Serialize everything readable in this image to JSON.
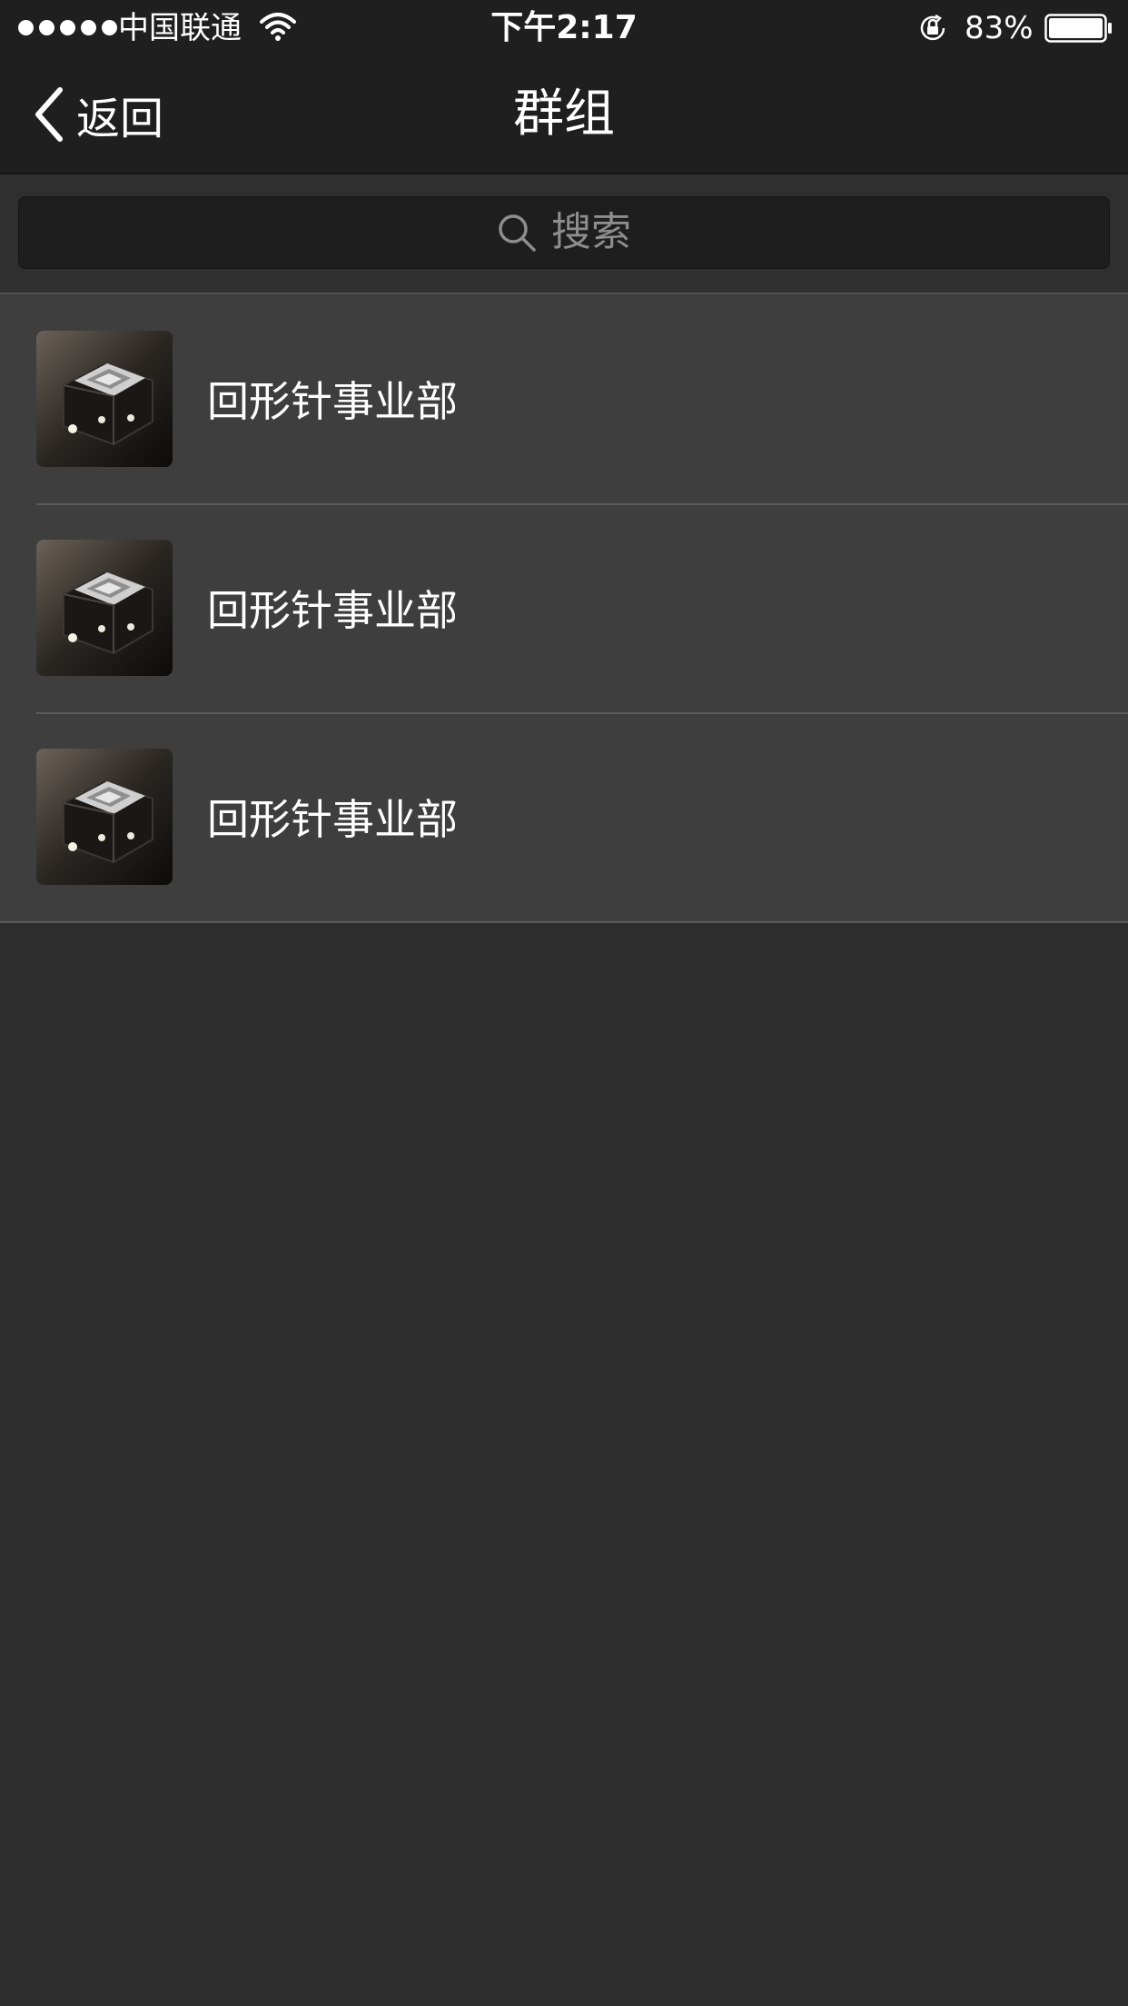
{
  "status_bar": {
    "carrier": "中国联通",
    "time": "下午2:17",
    "battery_percent": "83%",
    "signal_bars": 5,
    "battery_level": 0.83,
    "icons": [
      "signal-dots-icon",
      "wifi-icon",
      "rotation-lock-icon",
      "battery-icon"
    ]
  },
  "nav": {
    "back_label": "返回",
    "title": "群组",
    "back_icon": "chevron-left-icon"
  },
  "search": {
    "placeholder": "搜索",
    "icon": "search-icon"
  },
  "groups": [
    {
      "name": "回形针事业部",
      "avatar": "group-avatar-image"
    },
    {
      "name": "回形针事业部",
      "avatar": "group-avatar-image"
    },
    {
      "name": "回形针事业部",
      "avatar": "group-avatar-image"
    }
  ],
  "colors": {
    "bar_background": "#1f1f1f",
    "page_background": "#2d2d2d",
    "list_background": "#3e3e3e",
    "separator": "#5a5a5a",
    "text": "#ffffff",
    "placeholder": "#8d8d8d"
  }
}
